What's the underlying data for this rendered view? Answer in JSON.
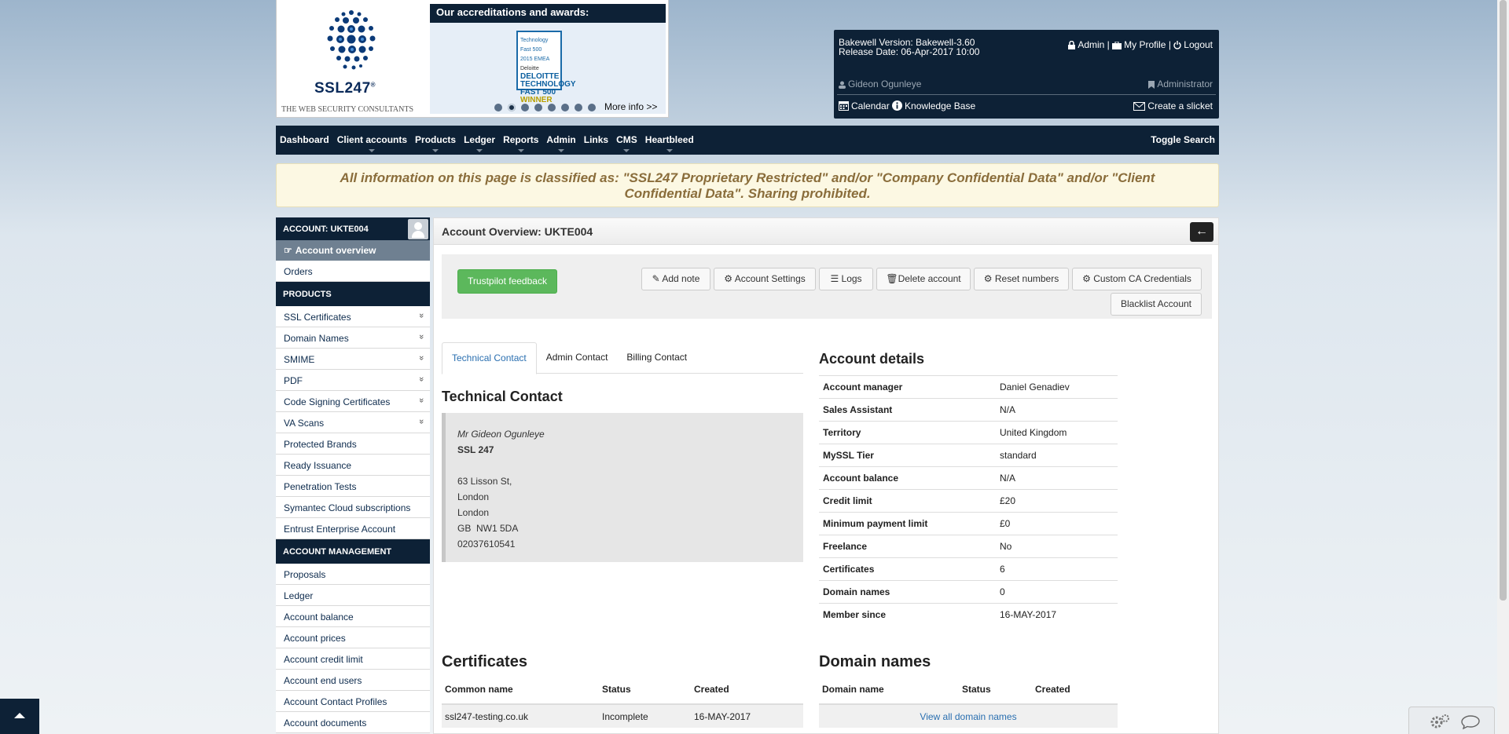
{
  "brand": {
    "name": "SSL247",
    "registered": "®",
    "tagline": "THE WEB SECURITY CONSULTANTS"
  },
  "awards": {
    "title": "Our accreditations and awards:",
    "badge_lines": [
      "Technology Fast 500",
      "2015 EMEA",
      "Deloitte",
      "DELOITTE",
      "TECHNOLOGY",
      "FAST 500",
      "WINNER"
    ],
    "more_info": "More info >>",
    "dot_count": 8,
    "active_dot": 1
  },
  "info": {
    "version": "Bakewell Version: Bakewell-3.60",
    "release": "Release Date: 06-Apr-2017 10:00",
    "admin_link": "Admin",
    "separator": "|",
    "profile_link": "My Profile",
    "logout_link": "Logout",
    "user": "Gideon Ogunleye",
    "role": "Administrator",
    "calendar": "Calendar",
    "knowledge": "Knowledge Base",
    "ticket": "Create a slicket"
  },
  "nav": {
    "items": [
      "Dashboard",
      "Client accounts",
      "Products",
      "Ledger",
      "Reports",
      "Admin",
      "Links",
      "CMS",
      "Heartbleed"
    ],
    "has_caret": [
      false,
      true,
      true,
      true,
      true,
      true,
      false,
      true,
      true
    ],
    "toggle_search": "Toggle Search"
  },
  "banner": "All information on this page is classified as: \"SSL247 Proprietary Restricted\" and/or \"Company Confidential Data\" and/or \"Client Confidential Data\". Sharing prohibited.",
  "sidebar": {
    "account_header": "ACCOUNT: UKTE004",
    "active_item": "Account overview",
    "orders": "Orders",
    "products_header": "PRODUCTS",
    "products": [
      {
        "label": "SSL Certificates",
        "expand": true
      },
      {
        "label": "Domain Names",
        "expand": true
      },
      {
        "label": "SMIME",
        "expand": true
      },
      {
        "label": "PDF",
        "expand": true
      },
      {
        "label": "Code Signing Certificates",
        "expand": true
      },
      {
        "label": "VA Scans",
        "expand": true
      },
      {
        "label": "Protected Brands",
        "expand": false
      },
      {
        "label": "Ready Issuance",
        "expand": false
      },
      {
        "label": "Penetration Tests",
        "expand": false
      },
      {
        "label": "Symantec Cloud subscriptions",
        "expand": false
      },
      {
        "label": "Entrust Enterprise Account",
        "expand": false
      }
    ],
    "management_header": "ACCOUNT MANAGEMENT",
    "management": [
      "Proposals",
      "Ledger",
      "Account balance",
      "Account prices",
      "Account credit limit",
      "Account end users",
      "Account Contact Profiles",
      "Account documents"
    ]
  },
  "panel": {
    "title": "Account Overview: UKTE004",
    "trustpilot": "Trustpilot feedback",
    "buttons": [
      "Add note",
      "Account Settings",
      "Logs",
      "Delete account",
      "Reset numbers",
      "Custom CA Credentials"
    ],
    "blacklist": "Blacklist Account",
    "tabs": [
      "Technical Contact",
      "Admin Contact",
      "Billing Contact"
    ],
    "contact_heading": "Technical Contact",
    "contact": {
      "name": "Mr Gideon Ogunleye",
      "company": "SSL 247",
      "lines": [
        "63 Lisson St,",
        "London",
        "London",
        "GB  NW1 5DA",
        "02037610541"
      ]
    },
    "details_heading": "Account details",
    "details": [
      {
        "k": "Account manager",
        "v": "Daniel Genadiev"
      },
      {
        "k": "Sales Assistant",
        "v": "N/A"
      },
      {
        "k": "Territory",
        "v": "United Kingdom"
      },
      {
        "k": "MySSL Tier",
        "v": "standard"
      },
      {
        "k": "Account balance",
        "v": "N/A"
      },
      {
        "k": "Credit limit",
        "v": "£20"
      },
      {
        "k": "Minimum payment limit",
        "v": "£0"
      },
      {
        "k": "Freelance",
        "v": "No"
      },
      {
        "k": "Certificates",
        "v": "6"
      },
      {
        "k": "Domain names",
        "v": "0"
      },
      {
        "k": "Member since",
        "v": "16-MAY-2017"
      }
    ],
    "certificates_heading": "Certificates",
    "cert_cols": [
      "Common name",
      "Status",
      "Created"
    ],
    "cert_rows": [
      [
        "ssl247-testing.co.uk",
        "Incomplete",
        "16-MAY-2017"
      ]
    ],
    "domains_heading": "Domain names",
    "domain_cols": [
      "Domain name",
      "Status",
      "Created"
    ],
    "view_all_domains": "View all domain names"
  },
  "colors": {
    "navy": "#0d2136",
    "green": "#5cb85c",
    "banner_text": "#8a6d3b",
    "link": "#2a6fb0"
  }
}
